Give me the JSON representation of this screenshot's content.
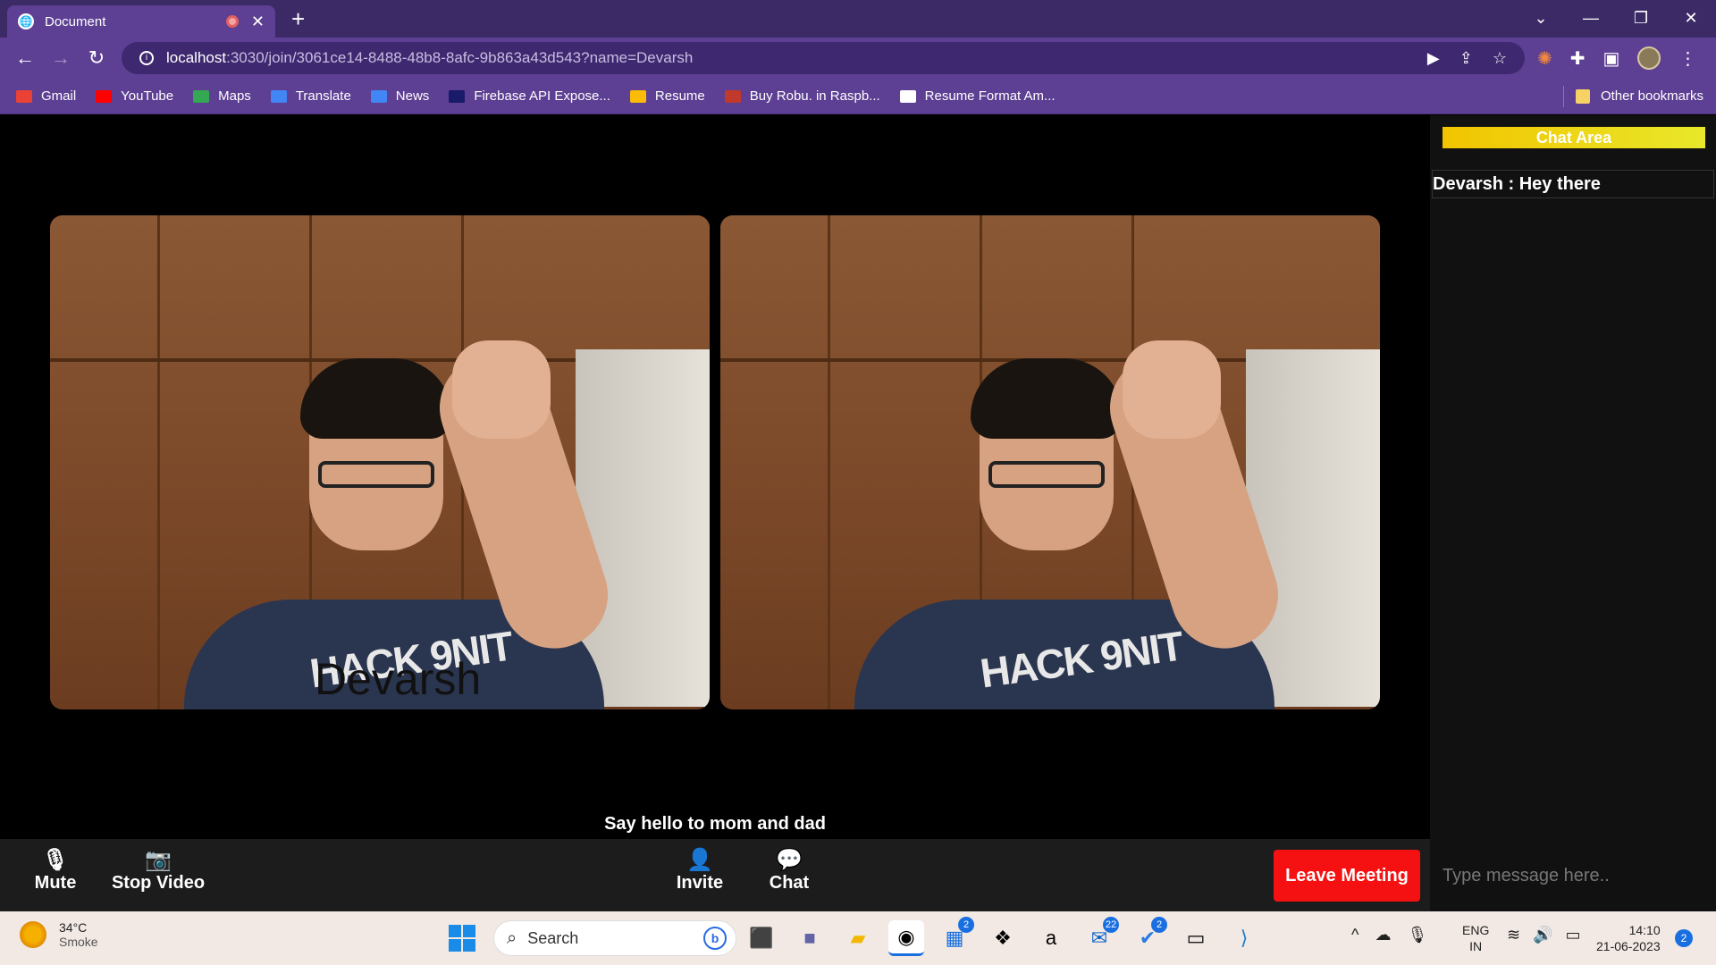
{
  "browser": {
    "tab_title": "Document",
    "url_host": "localhost",
    "url_path": ":3030/join/3061ce14-8488-48b8-8afc-9b863a43d543?name=Devarsh",
    "bookmarks": [
      {
        "label": "Gmail",
        "color": "#ea4335"
      },
      {
        "label": "YouTube",
        "color": "#ff0000"
      },
      {
        "label": "Maps",
        "color": "#34a853"
      },
      {
        "label": "Translate",
        "color": "#4285f4"
      },
      {
        "label": "News",
        "color": "#4285f4"
      },
      {
        "label": "Firebase API Expose...",
        "color": "#1a1a6a"
      },
      {
        "label": "Resume",
        "color": "#fbbc04"
      },
      {
        "label": "Buy Robu. in Raspb...",
        "color": "#c0392b"
      },
      {
        "label": "Resume Format Am...",
        "color": "#ffffff"
      }
    ],
    "other_bookmarks": "Other bookmarks"
  },
  "meeting": {
    "participant_name": "Devarsh",
    "shirt_text": "HACK 9NIT",
    "caption": "Say hello to mom and dad",
    "controls": {
      "mute": "Mute",
      "stop_video": "Stop Video",
      "invite": "Invite",
      "chat": "Chat",
      "leave": "Leave Meeting"
    },
    "leave_color": "#f51111"
  },
  "chat": {
    "header": "Chat Area",
    "messages": [
      {
        "text": "Devarsh : Hey there"
      }
    ],
    "input_placeholder": "Type message here.."
  },
  "taskbar": {
    "weather_temp": "34°C",
    "weather_desc": "Smoke",
    "search_placeholder": "Search",
    "lang_top": "ENG",
    "lang_bottom": "IN",
    "time": "14:10",
    "date": "21-06-2023",
    "notifications": "2",
    "badges": {
      "store": "2",
      "outlook": "22",
      "todo": "2"
    }
  }
}
